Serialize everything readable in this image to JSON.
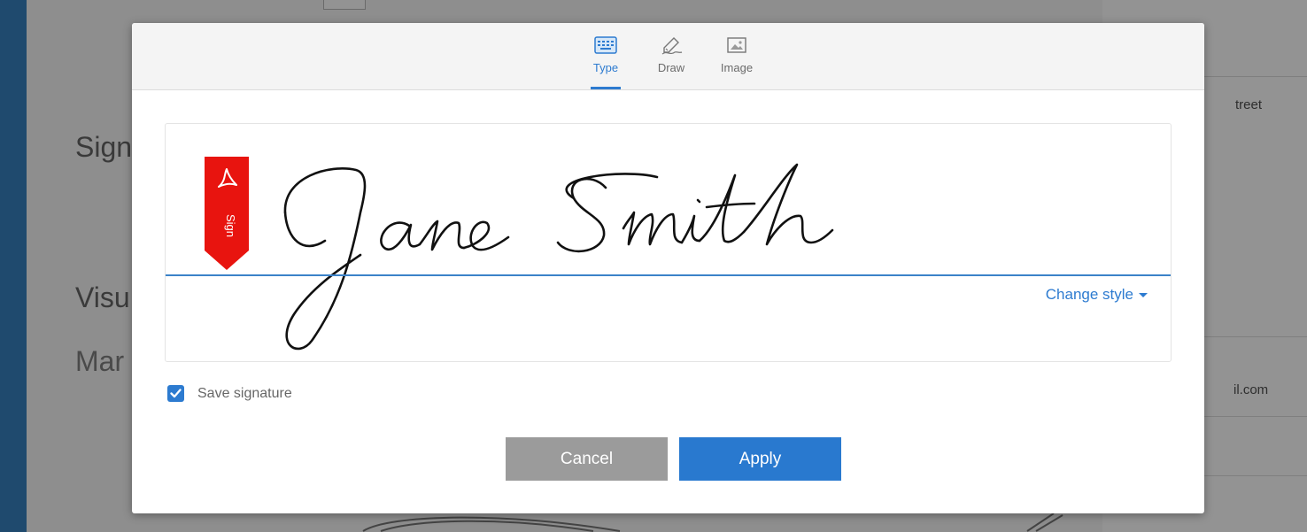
{
  "background": {
    "fragments": [
      "Sign",
      "Visu",
      "Mar"
    ],
    "right_fragments": [
      "treet",
      "il.com"
    ]
  },
  "tabs": [
    {
      "label": "Type",
      "icon": "keyboard-icon",
      "active": true
    },
    {
      "label": "Draw",
      "icon": "pen-icon",
      "active": false
    },
    {
      "label": "Image",
      "icon": "image-icon",
      "active": false
    }
  ],
  "signature": {
    "text": "Jane Smith",
    "badge_label": "Sign",
    "badge_color": "#e8140f",
    "change_style_label": "Change style"
  },
  "save_signature": {
    "label": "Save signature",
    "checked": true
  },
  "buttons": {
    "cancel": "Cancel",
    "apply": "Apply"
  },
  "colors": {
    "accent": "#2979cf",
    "cancel": "#9b9b9b"
  }
}
